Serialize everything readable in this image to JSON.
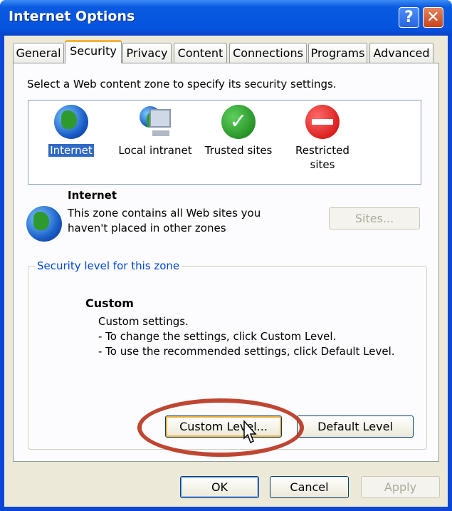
{
  "window": {
    "title": "Internet Options",
    "help_label": "?",
    "close_label": "✕"
  },
  "tabs": [
    {
      "label": "General"
    },
    {
      "label": "Security",
      "selected": true
    },
    {
      "label": "Privacy"
    },
    {
      "label": "Content"
    },
    {
      "label": "Connections"
    },
    {
      "label": "Programs"
    },
    {
      "label": "Advanced"
    }
  ],
  "security": {
    "instruction": "Select a Web content zone to specify its security settings.",
    "zones": [
      {
        "label": "Internet",
        "selected": true,
        "icon": "globe-icon"
      },
      {
        "label": "Local intranet",
        "icon": "computer-globe-icon"
      },
      {
        "label": "Trusted sites",
        "icon": "checkmark-icon"
      },
      {
        "label": "Restricted sites",
        "icon": "no-entry-icon"
      }
    ],
    "zone_name": "Internet",
    "zone_desc_1": "This zone contains all Web sites you",
    "zone_desc_2": "haven't placed in other zones",
    "sites_label": "Sites...",
    "group_label": "Security level for this zone",
    "level_name": "Custom",
    "level_lines": [
      "Custom settings.",
      "- To change the settings, click Custom Level.",
      "- To use the recommended settings, click Default Level."
    ],
    "custom_level_label": "Custom Level...",
    "default_level_label": "Default Level"
  },
  "footer": {
    "ok": "OK",
    "cancel": "Cancel",
    "apply": "Apply"
  },
  "colors": {
    "highlight_ellipse": "#b8321c",
    "titlebar": "#0553de",
    "group_label": "#0046d5"
  }
}
